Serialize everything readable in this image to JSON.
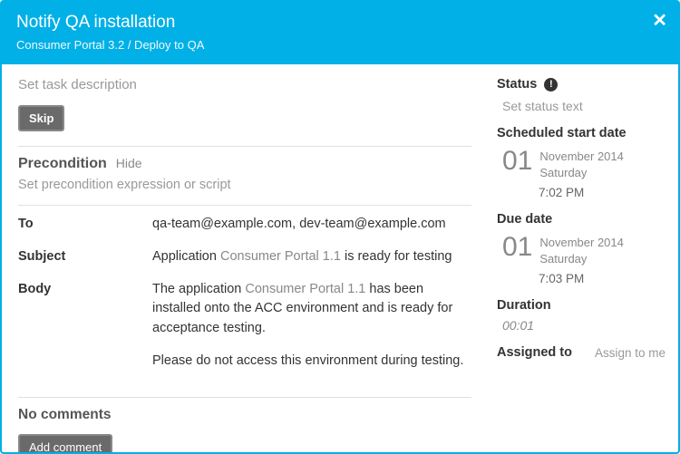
{
  "header": {
    "title": "Notify QA installation",
    "breadcrumb": "Consumer Portal 3.2 / Deploy to QA"
  },
  "main": {
    "task_description_placeholder": "Set task description",
    "skip_label": "Skip",
    "precondition_title": "Precondition",
    "hide_label": "Hide",
    "precondition_placeholder": "Set precondition expression or script",
    "to_label": "To",
    "to_value": "qa-team@example.com, dev-team@example.com",
    "subject_label": "Subject",
    "subject_prefix": "Application ",
    "subject_muted": "Consumer Portal 1.1",
    "subject_suffix": " is ready for testing",
    "body_label": "Body",
    "body_p1_prefix": "The application ",
    "body_p1_muted": "Consumer Portal 1.1",
    "body_p1_suffix": " has been installed onto the ACC environment and is ready for acceptance testing.",
    "body_p2": "Please do not access this environment during testing.",
    "comments_title": "No comments",
    "add_comment_label": "Add comment"
  },
  "sidebar": {
    "status_label": "Status",
    "status_placeholder": "Set status text",
    "scheduled_label": "Scheduled start date",
    "start_day": "01",
    "start_month_year": "November 2014",
    "start_weekday": "Saturday",
    "start_time": "7:02 PM",
    "due_label": "Due date",
    "due_day": "01",
    "due_month_year": "November 2014",
    "due_weekday": "Saturday",
    "due_time": "7:03 PM",
    "duration_label": "Duration",
    "duration_value": "00:01",
    "assigned_label": "Assigned to",
    "assign_to_me": "Assign to me"
  }
}
